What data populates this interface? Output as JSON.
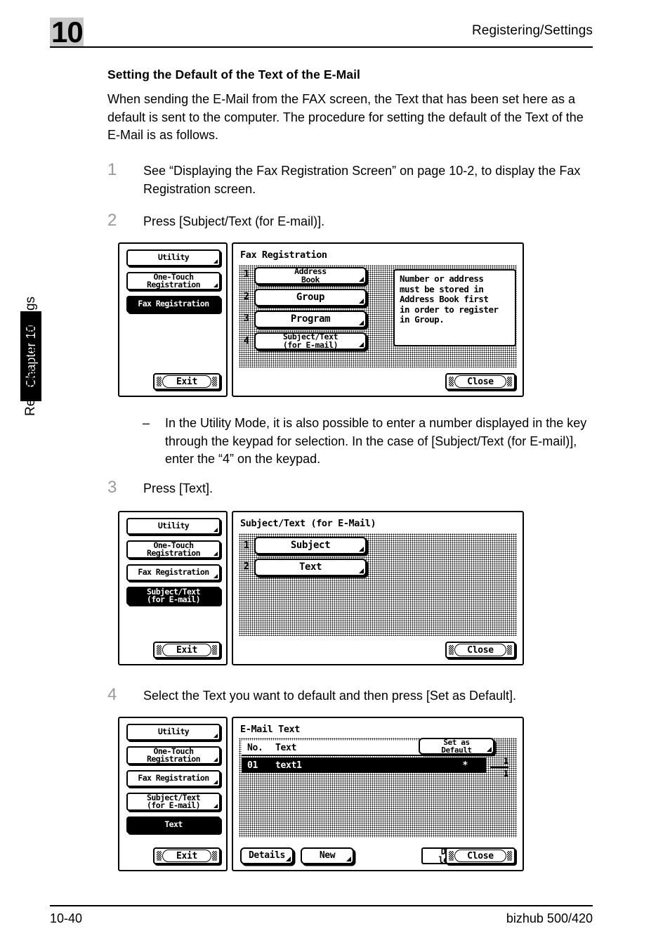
{
  "page": {
    "chapter_number": "10",
    "header_title": "Registering/Settings",
    "chapter_tab": "Chapter 10",
    "side_label": "Registering/Settings",
    "footer_left": "10-40",
    "footer_right": "bizhub 500/420"
  },
  "section": {
    "title": "Setting the Default of the Text of the E-Mail",
    "intro": "When sending the E-Mail from the FAX screen, the Text that has been set here as a default is sent to the computer. The procedure for setting the default of the Text of the E-Mail is as follows."
  },
  "steps": [
    {
      "num": "1",
      "text": "See “Displaying the Fax Registration Screen” on page 10-2, to display the Fax Registration screen."
    },
    {
      "num": "2",
      "text": "Press [Subject/Text (for E-mail)]."
    },
    {
      "num": "3",
      "text": "Press [Text]."
    },
    {
      "num": "4",
      "text": "Select the Text you want to default and then press [Set as Default]."
    }
  ],
  "note": {
    "dash": "–",
    "text": "In the Utility Mode, it is also possible to enter a number displayed in the key through the keypad for selection. In the case of [Subject/Text (for E-mail)], enter the “4” on the keypad."
  },
  "screen1": {
    "title": "Fax Registration",
    "nav": [
      {
        "label_line1": "Utility",
        "label_line2": "",
        "selected": false
      },
      {
        "label_line1": "One-Touch",
        "label_line2": "Registration",
        "selected": false
      },
      {
        "label_line1": "Fax Registration",
        "label_line2": "",
        "selected": true
      }
    ],
    "items": [
      {
        "index": "1",
        "label_line1": "Address",
        "label_line2": "Book"
      },
      {
        "index": "2",
        "label_line1": "Group",
        "label_line2": ""
      },
      {
        "index": "3",
        "label_line1": "Program",
        "label_line2": ""
      },
      {
        "index": "4",
        "label_line1": "Subject/Text",
        "label_line2": "(for E-mail)"
      }
    ],
    "message": "Number or address must be stored in Address Book first in order to register in Group.",
    "message_lines": [
      "Number or address",
      "must be stored in",
      "Address Book first",
      "in order to register",
      "in Group."
    ],
    "exit_label": "Exit",
    "close_label": "Close"
  },
  "screen2": {
    "title": "Subject/Text (for E-Mail)",
    "nav": [
      {
        "label_line1": "Utility",
        "label_line2": "",
        "selected": false
      },
      {
        "label_line1": "One-Touch",
        "label_line2": "Registration",
        "selected": false
      },
      {
        "label_line1": "Fax Registration",
        "label_line2": "",
        "selected": false
      },
      {
        "label_line1": "Subject/Text",
        "label_line2": "(for E-mail)",
        "selected": true
      }
    ],
    "items": [
      {
        "index": "1",
        "label_line1": "Subject",
        "label_line2": ""
      },
      {
        "index": "2",
        "label_line1": "Text",
        "label_line2": ""
      }
    ],
    "exit_label": "Exit",
    "close_label": "Close"
  },
  "screen3": {
    "title": "E-Mail Text",
    "nav": [
      {
        "label_line1": "Utility",
        "label_line2": "",
        "selected": false
      },
      {
        "label_line1": "One-Touch",
        "label_line2": "Registration",
        "selected": false
      },
      {
        "label_line1": "Fax Registration",
        "label_line2": "",
        "selected": false
      },
      {
        "label_line1": "Subject/Text",
        "label_line2": "(for E-mail)",
        "selected": false
      },
      {
        "label_line1": "Text",
        "label_line2": "",
        "selected": true
      }
    ],
    "set_default_line1": "Set as",
    "set_default_line2": "Default",
    "columns": {
      "no": "No.",
      "text": "Text"
    },
    "rows": [
      {
        "no": "01",
        "text": "text1",
        "default_mark": "*"
      }
    ],
    "page_current": "1",
    "page_total": "1",
    "buttons": {
      "details": "Details",
      "new": "New",
      "delete_line1": "De-",
      "delete_line2": "lete",
      "close": "Close"
    },
    "exit_label": "Exit"
  }
}
